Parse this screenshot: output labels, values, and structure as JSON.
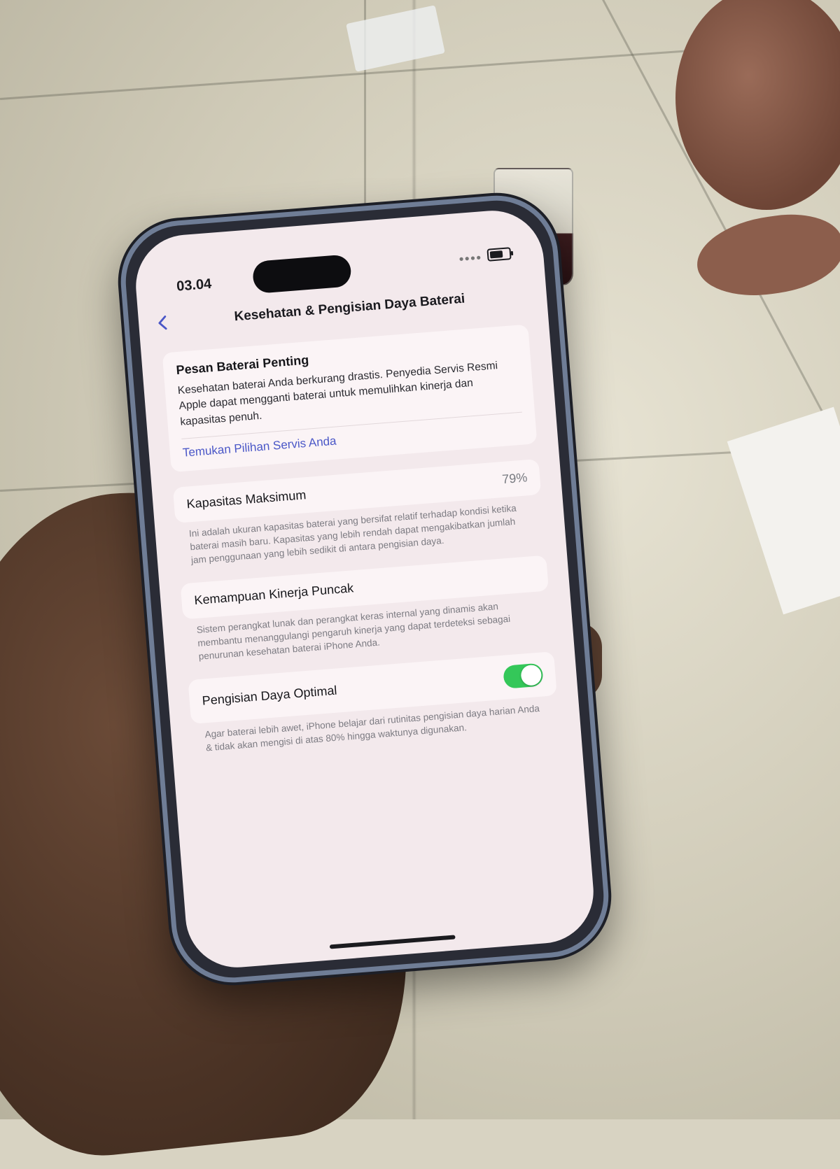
{
  "status_bar": {
    "time": "03.04"
  },
  "nav": {
    "title": "Kesehatan & Pengisian Daya Baterai",
    "back_icon": "chevron-left-icon"
  },
  "important_message": {
    "title": "Pesan Baterai Penting",
    "body": "Kesehatan baterai Anda berkurang drastis. Penyedia Servis Resmi Apple dapat mengganti baterai untuk memulihkan kinerja dan kapasitas penuh.",
    "link": "Temukan Pilihan Servis Anda"
  },
  "max_capacity": {
    "label": "Kapasitas Maksimum",
    "value": "79%",
    "footnote": "Ini adalah ukuran kapasitas baterai yang bersifat relatif terhadap kondisi ketika baterai masih baru. Kapasitas yang lebih rendah dapat mengakibatkan jumlah jam penggunaan yang lebih sedikit di antara pengisian daya."
  },
  "peak_performance": {
    "label": "Kemampuan Kinerja Puncak",
    "footnote": "Sistem perangkat lunak dan perangkat keras internal yang dinamis akan membantu menanggulangi pengaruh kinerja yang dapat terdeteksi sebagai penurunan kesehatan baterai iPhone Anda."
  },
  "optimized_charging": {
    "label": "Pengisian Daya Optimal",
    "enabled": true,
    "toggle_color": "#34c759",
    "footnote": "Agar baterai lebih awet, iPhone belajar dari rutinitas pengisian daya harian Anda & tidak akan mengisi di atas 80% hingga waktunya digunakan."
  },
  "colors": {
    "link": "#4a57c7",
    "screen_background": "#f3e9ec"
  }
}
